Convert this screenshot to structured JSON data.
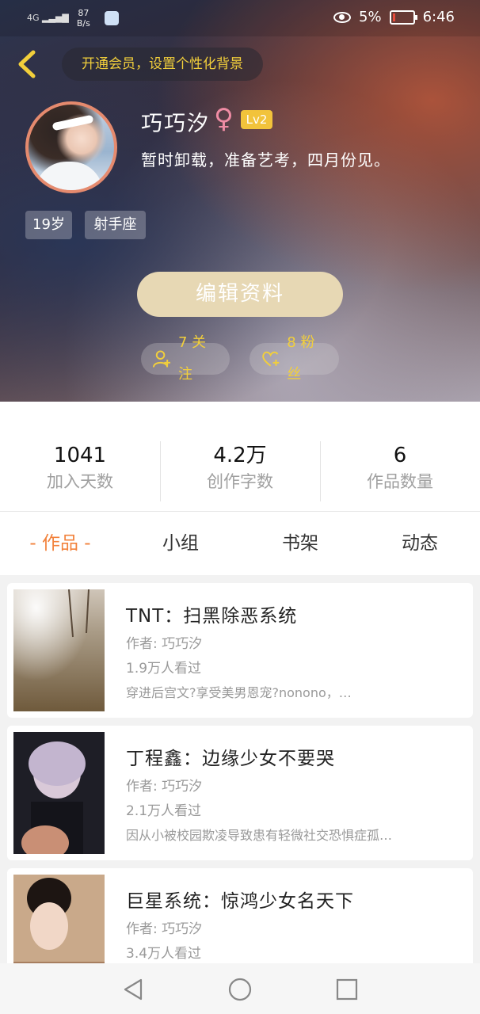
{
  "status_bar": {
    "signal": "4G",
    "speed_value": "87",
    "speed_unit": "B/s",
    "battery_pct": "5%",
    "time": "6:46"
  },
  "header": {
    "vip_banner": "开通会员，设置个性化背景"
  },
  "profile": {
    "name": "巧巧汐",
    "gender_symbol": "♀",
    "level": "Lv2",
    "bio": "暂时卸载，准备艺考，四月份见。",
    "tags": [
      "19岁",
      "射手座"
    ],
    "edit_label": "编辑资料",
    "following": "7 关注",
    "fans": "8 粉丝"
  },
  "stats": [
    {
      "value": "1041",
      "label": "加入天数"
    },
    {
      "value": "4.2万",
      "label": "创作字数"
    },
    {
      "value": "6",
      "label": "作品数量"
    }
  ],
  "tabs": [
    "- 作品 -",
    "小组",
    "书架",
    "动态"
  ],
  "active_tab": 0,
  "works": [
    {
      "title": "TNT：扫黑除恶系统",
      "author": "作者: 巧巧汐",
      "views": "1.9万人看过",
      "desc": "穿进后宫文?享受美男恩宠?nonono，…"
    },
    {
      "title": "丁程鑫：边缘少女不要哭",
      "author": "作者: 巧巧汐",
      "views": "2.1万人看过",
      "desc": "因从小被校园欺凌导致患有轻微社交恐惧症孤…"
    },
    {
      "title": "巨星系统：惊鸿少女名天下",
      "author": "作者: 巧巧汐",
      "views": "3.4万人看过",
      "desc": ""
    }
  ],
  "colors": {
    "accent": "#f2823c",
    "gold": "#f2cf3b",
    "edit_button": "#e7d8b4"
  },
  "icons": {
    "back": "chevron-left-icon",
    "follow": "user-plus-icon",
    "fans": "heart-plus-icon",
    "nav_back": "triangle-back-icon",
    "nav_home": "circle-home-icon",
    "nav_recent": "square-recent-icon"
  }
}
